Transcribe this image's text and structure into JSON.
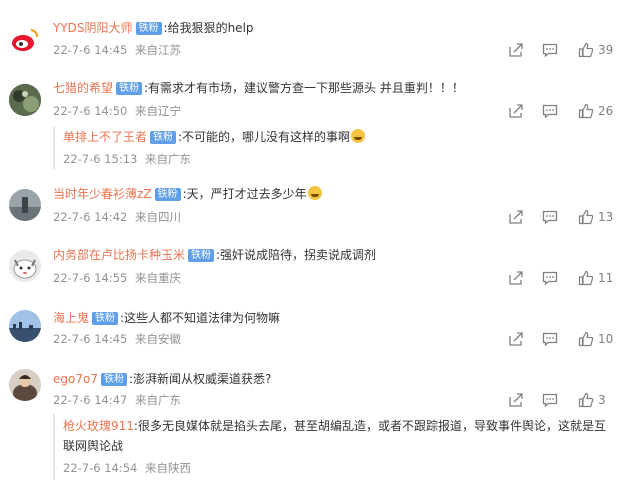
{
  "comments": [
    {
      "user": "YYDS阴阳大师",
      "badge": "铁粉",
      "text": ":给我狠狠的help",
      "date": "22-7-6 14:45",
      "location": "来自江苏",
      "likes": "39"
    },
    {
      "user": "七猎的希望",
      "badge": "铁粉",
      "text": ":有需求才有市场，建议警方查一下那些源头  并且重判！！！",
      "date": "22-7-6 14:50",
      "location": "来自辽宁",
      "likes": "26",
      "reply": {
        "user": "单排上不了王者",
        "badge": "铁粉",
        "text": ":不可能的，哪儿没有这样的事啊",
        "emoji": "sweat-smile-emoji",
        "date": "22-7-6 15:13",
        "location": "来自广东"
      }
    },
    {
      "user": "当时年少春衫薄zZ",
      "badge": "铁粉",
      "text": ":天，严打才过去多少年",
      "emoji": "crying-emoji",
      "date": "22-7-6 14:42",
      "location": "来自四川",
      "likes": "13"
    },
    {
      "user": "内务部在卢比扬卡种玉米",
      "badge": "铁粉",
      "text": ":强奸说成陪待，拐卖说成调剂",
      "date": "22-7-6 14:55",
      "location": "来自重庆",
      "likes": "11"
    },
    {
      "user": "海上鬼",
      "badge": "铁粉",
      "text": ":这些人都不知道法律为何物嘛",
      "date": "22-7-6 14:45",
      "location": "来自安徽",
      "likes": "10"
    },
    {
      "user": "ego7o7",
      "badge": "铁粉",
      "text": ":澎湃新闻从权威渠道获悉?",
      "date": "22-7-6 14:47",
      "location": "来自广东",
      "likes": "3",
      "reply": {
        "user": "枪火玫瑰911",
        "text_line1": ":很多无良媒体就是掐头去尾，甚至胡编乱造，或者不跟踪报道，导致事件舆论，这就是互",
        "text_line2": "联网舆论战",
        "date": "22-7-6 14:54",
        "location": "来自陕西"
      }
    }
  ],
  "colors": {
    "username": "#eb7350",
    "badge": "#5f9ee8",
    "meta": "#939393",
    "icon": "#808080"
  },
  "icons": [
    "share-icon",
    "comment-icon",
    "like-icon"
  ]
}
